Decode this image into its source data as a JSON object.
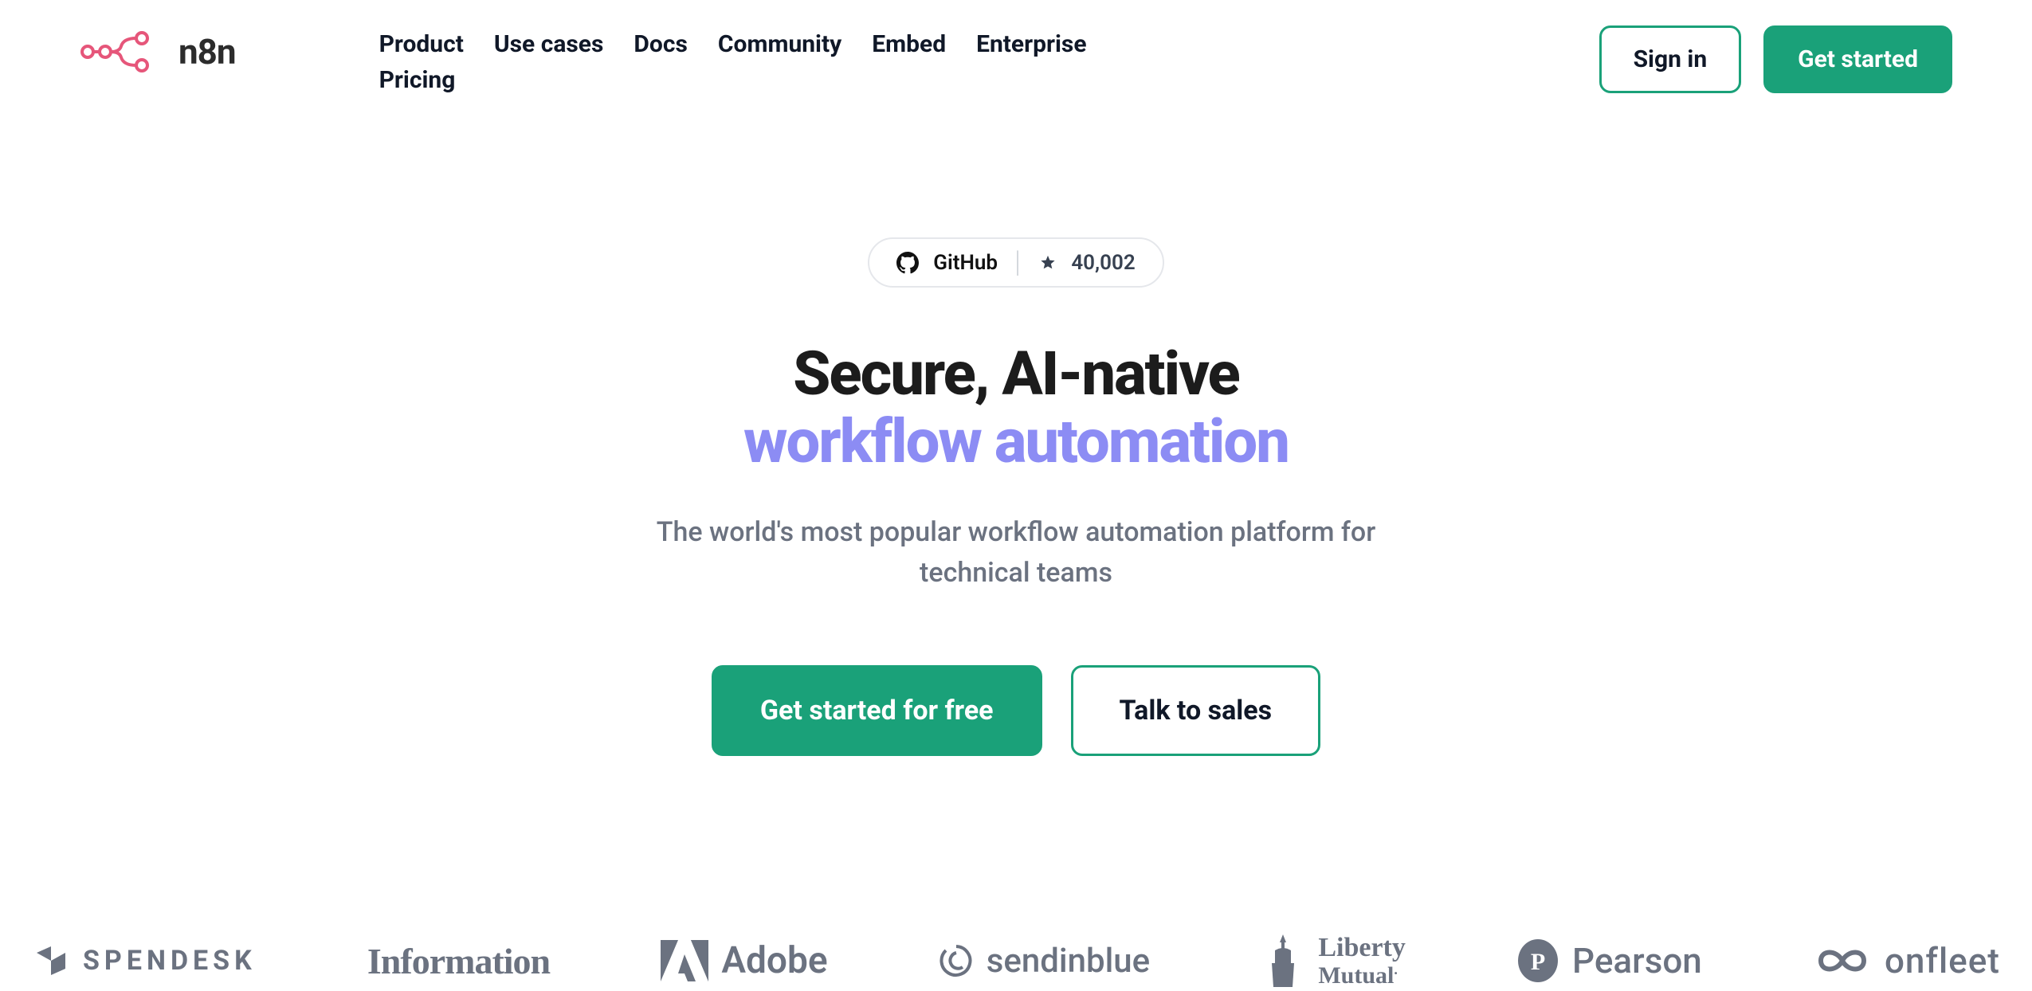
{
  "brand": {
    "name": "n8n"
  },
  "nav": {
    "items": [
      "Product",
      "Use cases",
      "Docs",
      "Community",
      "Embed",
      "Enterprise",
      "Pricing"
    ]
  },
  "header": {
    "sign_in": "Sign in",
    "get_started": "Get started"
  },
  "github": {
    "label": "GitHub",
    "stars": "40,002"
  },
  "hero": {
    "title_line1": "Secure, AI-native",
    "title_line2": "workflow automation",
    "subtitle": "The world's most popular workflow automation platform for technical teams",
    "cta_primary": "Get started for free",
    "cta_secondary": "Talk to sales"
  },
  "partners": {
    "spendesk": "SPENDESK",
    "information": "Information",
    "adobe": "Adobe",
    "sendinblue": "sendinblue",
    "liberty_line1": "Liberty",
    "liberty_line2": "Mutual",
    "pearson": "Pearson",
    "onfleet": "onfleet"
  },
  "colors": {
    "accent_green": "#1aa179",
    "accent_purple": "#8c8cf4",
    "logo_pink": "#e6567a"
  }
}
